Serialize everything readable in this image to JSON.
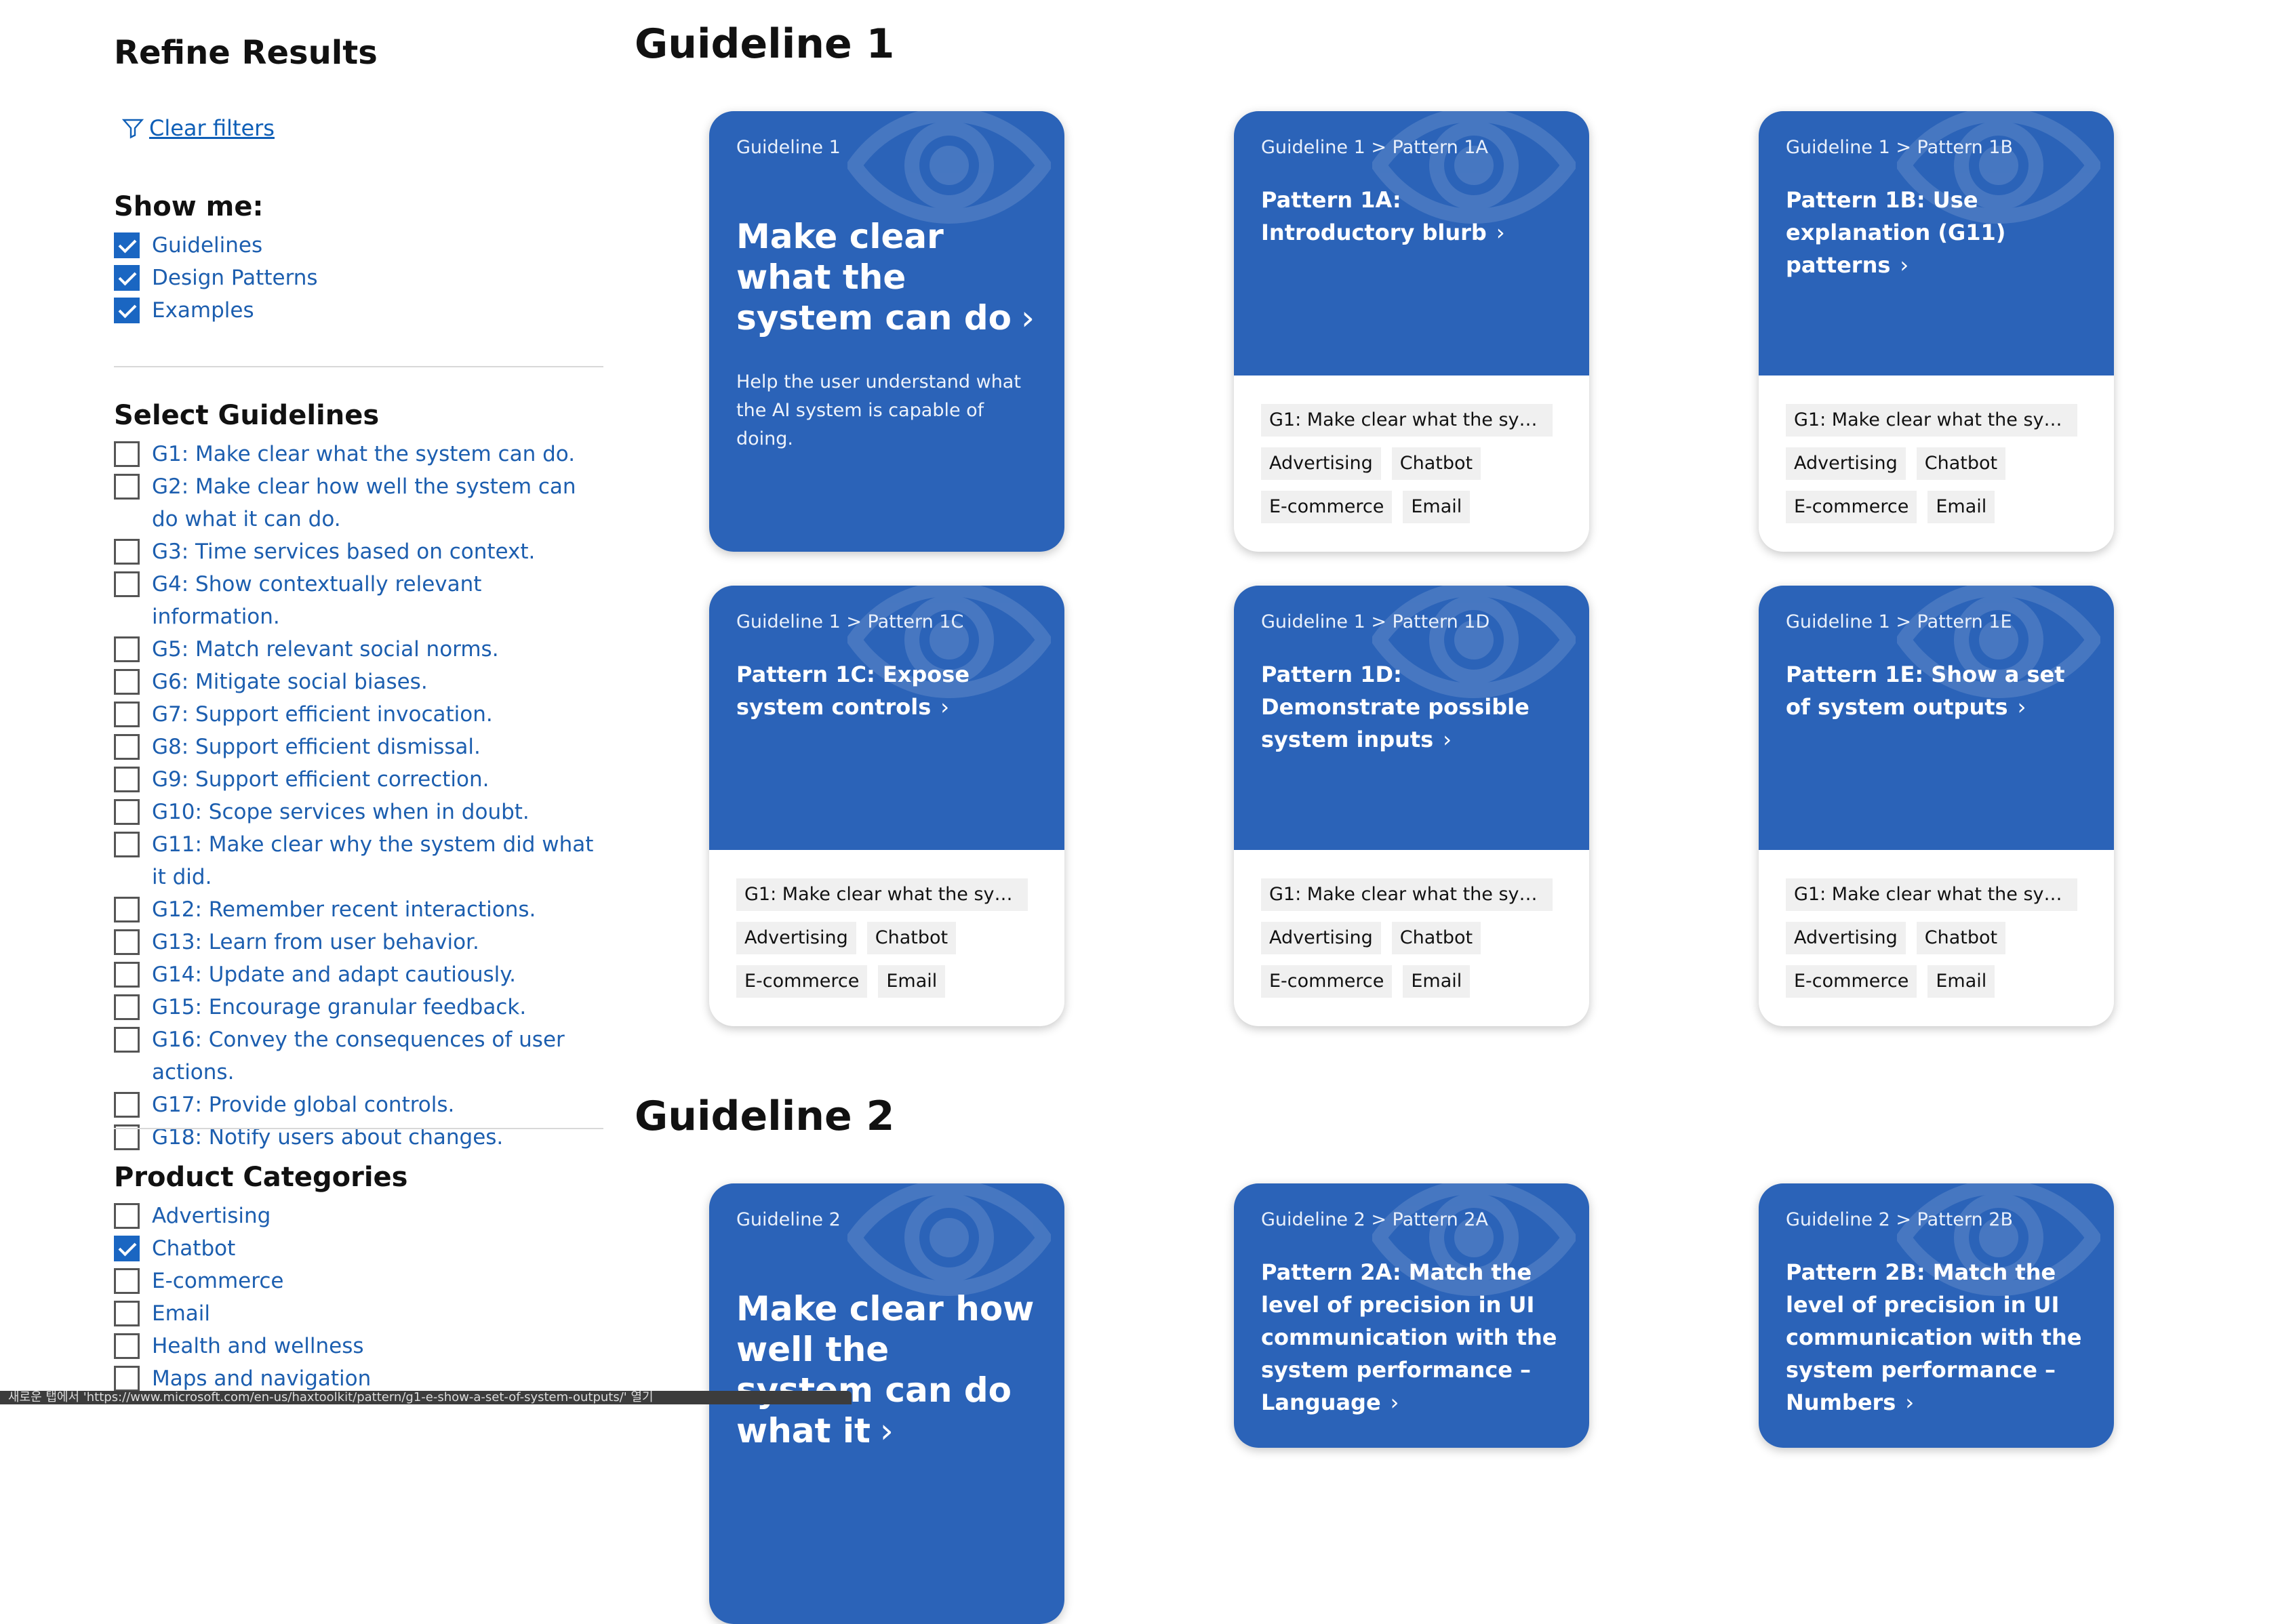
{
  "sidebar": {
    "title": "Refine Results",
    "clear_filters": "Clear filters",
    "show_me": {
      "heading": "Show me:",
      "items": [
        {
          "label": "Guidelines",
          "checked": true
        },
        {
          "label": "Design Patterns",
          "checked": true
        },
        {
          "label": "Examples",
          "checked": true
        }
      ]
    },
    "guidelines": {
      "heading": "Select Guidelines",
      "items": [
        {
          "label": "G1: Make clear what the system can do.",
          "checked": false
        },
        {
          "label": "G2: Make clear how well the system can do what it can do.",
          "checked": false
        },
        {
          "label": "G3: Time services based on context.",
          "checked": false
        },
        {
          "label": "G4: Show contextually relevant information.",
          "checked": false
        },
        {
          "label": "G5: Match relevant social norms.",
          "checked": false
        },
        {
          "label": "G6: Mitigate social biases.",
          "checked": false
        },
        {
          "label": "G7: Support efficient invocation.",
          "checked": false
        },
        {
          "label": "G8: Support efficient dismissal.",
          "checked": false
        },
        {
          "label": "G9: Support efficient correction.",
          "checked": false
        },
        {
          "label": "G10: Scope services when in doubt.",
          "checked": false
        },
        {
          "label": "G11: Make clear why the system did what it did.",
          "checked": false
        },
        {
          "label": "G12: Remember recent interactions.",
          "checked": false
        },
        {
          "label": "G13: Learn from user behavior.",
          "checked": false
        },
        {
          "label": "G14: Update and adapt cautiously.",
          "checked": false
        },
        {
          "label": "G15: Encourage granular feedback.",
          "checked": false
        },
        {
          "label": "G16: Convey the consequences of user actions.",
          "checked": false
        },
        {
          "label": "G17: Provide global controls.",
          "checked": false
        },
        {
          "label": "G18: Notify users about changes.",
          "checked": false
        }
      ]
    },
    "categories": {
      "heading": "Product Categories",
      "items": [
        {
          "label": "Advertising",
          "checked": false
        },
        {
          "label": "Chatbot",
          "checked": true
        },
        {
          "label": "E-commerce",
          "checked": false
        },
        {
          "label": "Email",
          "checked": false
        },
        {
          "label": "Health and wellness",
          "checked": false
        },
        {
          "label": "Maps and navigation",
          "checked": false
        }
      ]
    }
  },
  "main": {
    "sections": [
      {
        "heading": "Guideline 1",
        "cards": [
          {
            "crumb": "Guideline 1",
            "title": "Make clear what the system can do",
            "desc": "Help the user understand what the AI system is capable of doing.",
            "big": true
          },
          {
            "crumb": "Guideline 1 > Pattern 1A",
            "title": "Pattern 1A: Introductory blurb",
            "tags": [
              "G1: Make clear what the syste...",
              "Advertising",
              "Chatbot",
              "E-commerce",
              "Email"
            ]
          },
          {
            "crumb": "Guideline 1 > Pattern 1B",
            "title": "Pattern 1B: Use explanation (G11) patterns",
            "tags": [
              "G1: Make clear what the syste...",
              "Advertising",
              "Chatbot",
              "E-commerce",
              "Email"
            ]
          },
          {
            "crumb": "Guideline 1 > Pattern 1C",
            "title": "Pattern 1C: Expose system controls",
            "tags": [
              "G1: Make clear what the syste...",
              "Advertising",
              "Chatbot",
              "E-commerce",
              "Email"
            ]
          },
          {
            "crumb": "Guideline 1 > Pattern 1D",
            "title": "Pattern 1D: Demonstrate possible system inputs",
            "tags": [
              "G1: Make clear what the syste...",
              "Advertising",
              "Chatbot",
              "E-commerce",
              "Email"
            ]
          },
          {
            "crumb": "Guideline 1 > Pattern 1E",
            "title": "Pattern 1E: Show a set of system outputs",
            "tags": [
              "G1: Make clear what the syste...",
              "Advertising",
              "Chatbot",
              "E-commerce",
              "Email"
            ]
          }
        ]
      },
      {
        "heading": "Guideline 2",
        "cards": [
          {
            "crumb": "Guideline 2",
            "title": "Make clear how well the system can do what it",
            "big": true
          },
          {
            "crumb": "Guideline 2 > Pattern 2A",
            "title": "Pattern 2A: Match the level of precision in UI communication with the system performance – Language"
          },
          {
            "crumb": "Guideline 2 > Pattern 2B",
            "title": "Pattern 2B: Match the level of precision in UI communication with the system performance – Numbers"
          }
        ]
      }
    ],
    "chevron": "›"
  },
  "statusbar": "새로운 탭에서 'https://www.microsoft.com/en-us/haxtoolkit/pattern/g1-e-show-a-set-of-system-outputs/' 열기",
  "colors": {
    "card_blue": "#2b63b8",
    "link_blue": "#1c5eaf",
    "checkbox_blue": "#1a66c2"
  }
}
